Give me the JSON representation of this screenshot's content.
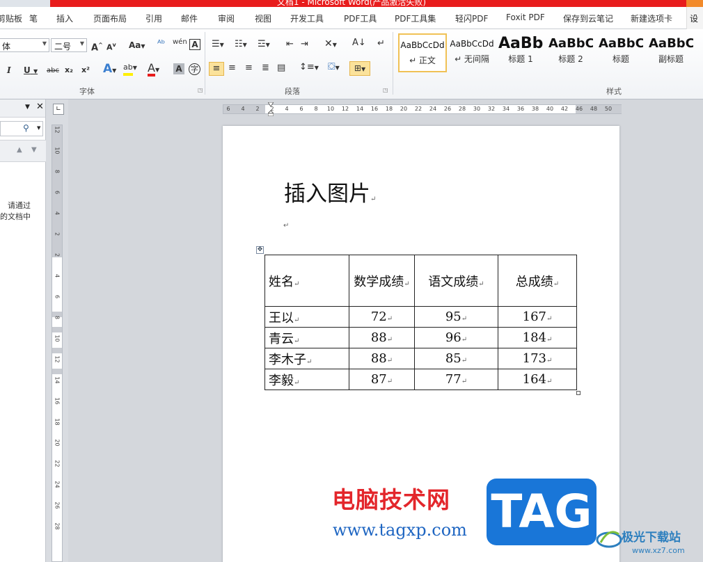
{
  "window": {
    "title": "文档1 - Microsoft Word(产品激活失败)"
  },
  "tabs": [
    {
      "label": "剪贴板"
    },
    {
      "label": "笔"
    },
    {
      "label": "插入"
    },
    {
      "label": "页面布局"
    },
    {
      "label": "引用"
    },
    {
      "label": "邮件"
    },
    {
      "label": "审阅"
    },
    {
      "label": "视图"
    },
    {
      "label": "开发工具"
    },
    {
      "label": "PDF工具"
    },
    {
      "label": "PDF工具集"
    },
    {
      "label": "轻闪PDF"
    },
    {
      "label": "Foxit PDF"
    },
    {
      "label": "保存到云笔记"
    },
    {
      "label": "新建选项卡"
    },
    {
      "label": "设"
    }
  ],
  "ribbon": {
    "font": {
      "font_name": "体",
      "font_size": "二号",
      "grow_label": "A",
      "shrink_label": "A",
      "case_label": "Aa",
      "phonetic_label": "wén",
      "italic": "I",
      "underline": "U",
      "strike": "abc",
      "subscript": "x₂",
      "superscript": "x²",
      "group_label": "字体"
    },
    "paragraph": {
      "group_label": "段落"
    },
    "styles": {
      "group_label": "样式",
      "items": [
        {
          "sample": "AaBbCcDd",
          "name": "↵ 正文",
          "selected": true
        },
        {
          "sample": "AaBbCcDd",
          "name": "↵ 无间隔",
          "selected": false
        },
        {
          "sample": "AaBb",
          "name": "标题 1",
          "selected": false
        },
        {
          "sample": "AaBbC",
          "name": "标题 2",
          "selected": false
        },
        {
          "sample": "AaBbC",
          "name": "标题",
          "selected": false
        },
        {
          "sample": "AaBbC",
          "name": "副标题",
          "selected": false
        }
      ]
    }
  },
  "nav_pane": {
    "hint_text": "请通过\n的文档中"
  },
  "hruler_numbers": [
    "6",
    "4",
    "2",
    "2",
    "4",
    "6",
    "8",
    "10",
    "12",
    "14",
    "16",
    "18",
    "20",
    "22",
    "24",
    "26",
    "28",
    "30",
    "32",
    "34",
    "36",
    "38",
    "40",
    "42",
    "46",
    "48",
    "50"
  ],
  "vruler_numbers": [
    "12",
    "10",
    "8",
    "6",
    "4",
    "2",
    "2",
    "4",
    "6",
    "8",
    "10",
    "12",
    "14",
    "16",
    "18",
    "20",
    "22",
    "24",
    "26",
    "28"
  ],
  "document": {
    "title": "插入图片",
    "table": {
      "headers": [
        "姓名",
        "数学成绩",
        "语文成绩",
        "总成绩"
      ],
      "rows": [
        [
          "王以",
          "72",
          "95",
          "167"
        ],
        [
          "青云",
          "88",
          "96",
          "184"
        ],
        [
          "李木子",
          "88",
          "85",
          "173"
        ],
        [
          "李毅",
          "87",
          "77",
          "164"
        ]
      ]
    }
  },
  "watermarks": {
    "cn_text": "电脑技术网",
    "url": "www.tagxp.com",
    "tag": "TAG",
    "jiguang": "极光下载站",
    "jiguang_url": "www.xz7.com"
  },
  "colors": {
    "title_bar": "#e81c1c",
    "highlight": "#fbe29b",
    "watermark_red": "#e3262b",
    "watermark_blue": "#1976d8"
  }
}
